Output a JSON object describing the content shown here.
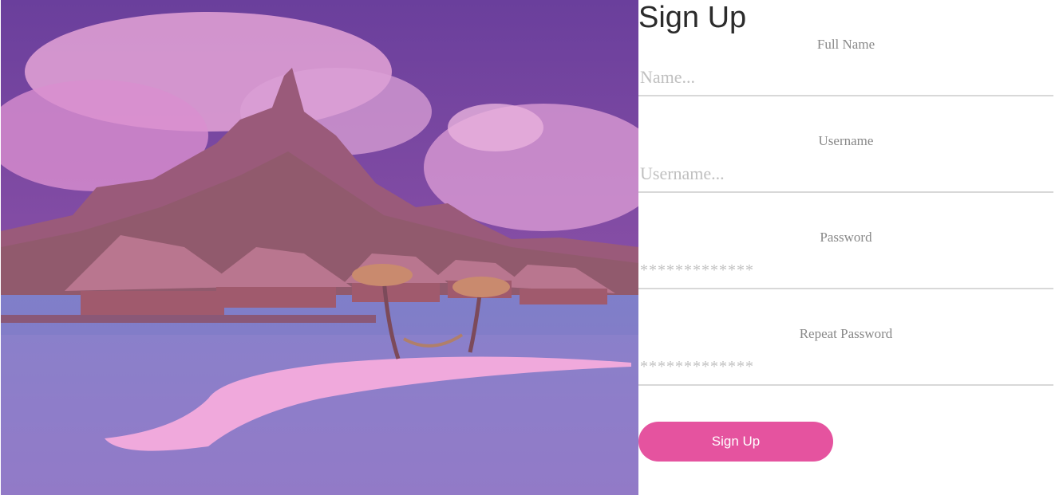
{
  "colors": {
    "accent": "#e5539f",
    "overlay": "#a64ab0"
  },
  "hero": {
    "image": "tropical-island-overwater-bungalows"
  },
  "form": {
    "title": "Sign Up",
    "fields": [
      {
        "label": "Full Name",
        "placeholder": "Name...",
        "type": "text"
      },
      {
        "label": "Username",
        "placeholder": "Username...",
        "type": "text"
      },
      {
        "label": "Password",
        "placeholder": "*************",
        "type": "password"
      },
      {
        "label": "Repeat Password",
        "placeholder": "*************",
        "type": "password"
      }
    ],
    "submit_label": "Sign Up"
  }
}
